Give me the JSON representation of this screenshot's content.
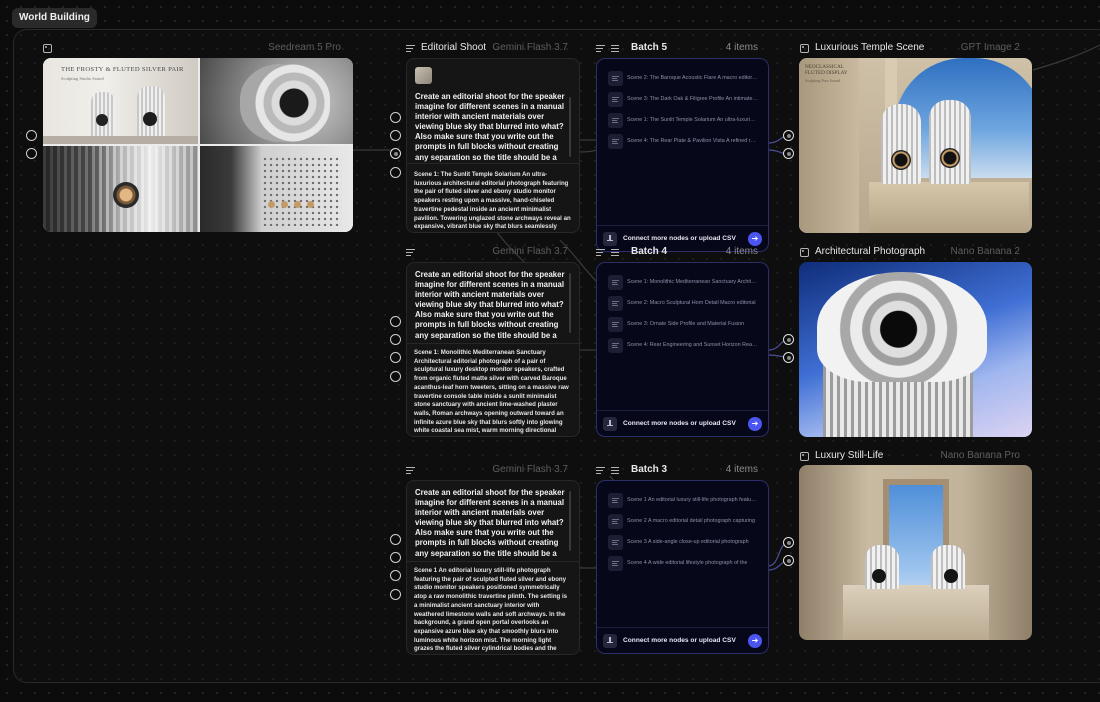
{
  "group": {
    "label": "World Building"
  },
  "seedream_node": {
    "model": "Seedream 5 Pro",
    "icon": "image-icon"
  },
  "editorial_node_1": {
    "title": "Editorial Shoot",
    "model": "Gemini Flash 3.7",
    "prompt": "Create an editorial shoot for the speaker imagine for different scenes in a manual interior with ancient materials over viewing blue sky that blurred into what? Also make sure that you write out the prompts in full blocks without creating any separation so the title should be a space and then the prompt",
    "output": "Scene 1: The Sunlit Temple Solarium An ultra-luxurious architectural editorial photograph featuring the pair of fluted silver and ebony studio monitor speakers resting upon a massive, hand-chiseled travertine pedestal inside an ancient minimalist pavilion. Towering unglazed stone archways reveal an expansive, vibrant blue sky that blurs seamlessly"
  },
  "editorial_node_2": {
    "title": "",
    "model": "Gemini Flash 3.7",
    "prompt": "Create an editorial shoot for the speaker imagine for different scenes in a manual interior with ancient materials over viewing blue sky that blurred into what? Also make sure that you write out the prompts in full blocks without creating any separation so the title should be a space and then the prompt",
    "output": "Scene 1: Monolithic Mediterranean Sanctuary Architectural editorial photograph of a pair of sculptural luxury desktop monitor speakers, crafted from organic fluted matte silver with carved Baroque acanthus-leaf horn tweeters, sitting on a massive raw travertine console table inside a sunlit minimalist stone sanctuary with ancient lime-washed plaster walls, Roman archways opening outward toward an infinite azure blue sky that blurs softly into glowing white coastal sea mist, warm morning directional"
  },
  "editorial_node_3": {
    "title": "",
    "model": "Gemini Flash 3.7",
    "prompt": "Create an editorial shoot for the speaker imagine for different scenes in a manual interior with ancient materials over viewing blue sky that blurred into what? Also make sure that you write out the prompts in full blocks without creating any separation so the title should be a space and then the prompt",
    "output": "Scene 1 An editorial luxury still-life photograph featuring the pair of sculpted fluted silver and ebony studio monitor speakers positioned symmetrically atop a raw monolithic travertine plinth. The setting is a minimalist ancient sanctuary interior with weathered limestone walls and soft archways. In the background, a grand open portal overlooks an expansive azure blue sky that smoothly blurs into luminous white horizon mist. The morning light grazes the fluted silver cylindrical bodies and the"
  },
  "batches": [
    {
      "title": "Batch 5",
      "count": "4 items",
      "items": [
        "Scene 2: The Baroque Acoustic Flare A macro editorial close-up",
        "Scene 3: The Dark Oak & Filigree Profile An intimate side",
        "Scene 1: The Sunlit Temple Solarium An ultra-luxurious",
        "Scene 4: The Rear Plate & Pavilion Vista A refined rear view"
      ],
      "footer": "Connect more nodes or upload CSV"
    },
    {
      "title": "Batch 4",
      "count": "4 items",
      "items": [
        "Scene 1: Monolithic Mediterranean Sanctuary Architectural",
        "Scene 2: Macro Sculptural Horn Detail Macro editorial",
        "Scene 3: Ornate Side Profile and Material Fusion",
        "Scene 4: Rear Engineering and Sunset Horizon Rear view"
      ],
      "footer": "Connect more nodes or upload CSV"
    },
    {
      "title": "Batch 3",
      "count": "4 items",
      "items": [
        "Scene 1 An editorial luxury still-life photograph featuring",
        "Scene 2 A macro editorial detail photograph capturing",
        "Scene 3 A side-angle close-up editorial photograph",
        "Scene 4 A wide editorial lifestyle photograph of the"
      ],
      "footer": "Connect more nodes or upload CSV"
    }
  ],
  "outputs": [
    {
      "title": "Luxurious Temple Scene",
      "model": "GPT Image 2"
    },
    {
      "title": "Architectural Photograph",
      "model": "Nano Banana 2"
    },
    {
      "title": "Luxury Still-Life",
      "model": "Nano Banana Pro"
    }
  ],
  "seedream_tiles": {
    "magazine_title": "THE FROSTY & FLUTED SILVER PAIR",
    "magazine_sub": "Sculpting Studio Sound"
  },
  "temple_magazine": {
    "title": "NEOCLASSICAL FLUTED DISPLAY",
    "sub": "Sculpting Pure Sound"
  },
  "colors": {
    "accent": "#4b55f0",
    "batch_border": "#2b2e6a",
    "batch_bg": "#07071a"
  }
}
